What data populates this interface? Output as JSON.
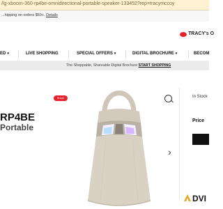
{
  "browser": {
    "url_text": "/lg-xboom-360-rp4be-omnidirectional-portable-speaker-133452?rep=tracymccoy"
  },
  "promo": {
    "text": "...hipping on orders $50+.",
    "link": "Details"
  },
  "header": {
    "logo_text": "TRACY's O"
  },
  "nav": {
    "items": [
      {
        "label": "ED",
        "chevron": true
      },
      {
        "label": "LIVE SHOPPING",
        "chevron": false
      },
      {
        "label": "SPECIAL OFFERS",
        "chevron": true
      },
      {
        "label": "DIGITAL BROCHURE",
        "chevron": true
      },
      {
        "label": "BECOM",
        "chevron": false
      }
    ]
  },
  "tagline": {
    "text": "The Shoppable, Shareable Digital Brochure",
    "link": "START SHOPPING"
  },
  "product": {
    "title_line1": "RP4BE",
    "title_line2": "Portable",
    "share_label": "Share",
    "stock": "In Stock",
    "price_label": "Price",
    "next_arrow": "›"
  },
  "watermark": {
    "text": "DVI"
  },
  "colors": {
    "brand_red": "#e8222d",
    "url_bar": "#fdf1d2",
    "speaker_body": "#d9d1c4"
  }
}
